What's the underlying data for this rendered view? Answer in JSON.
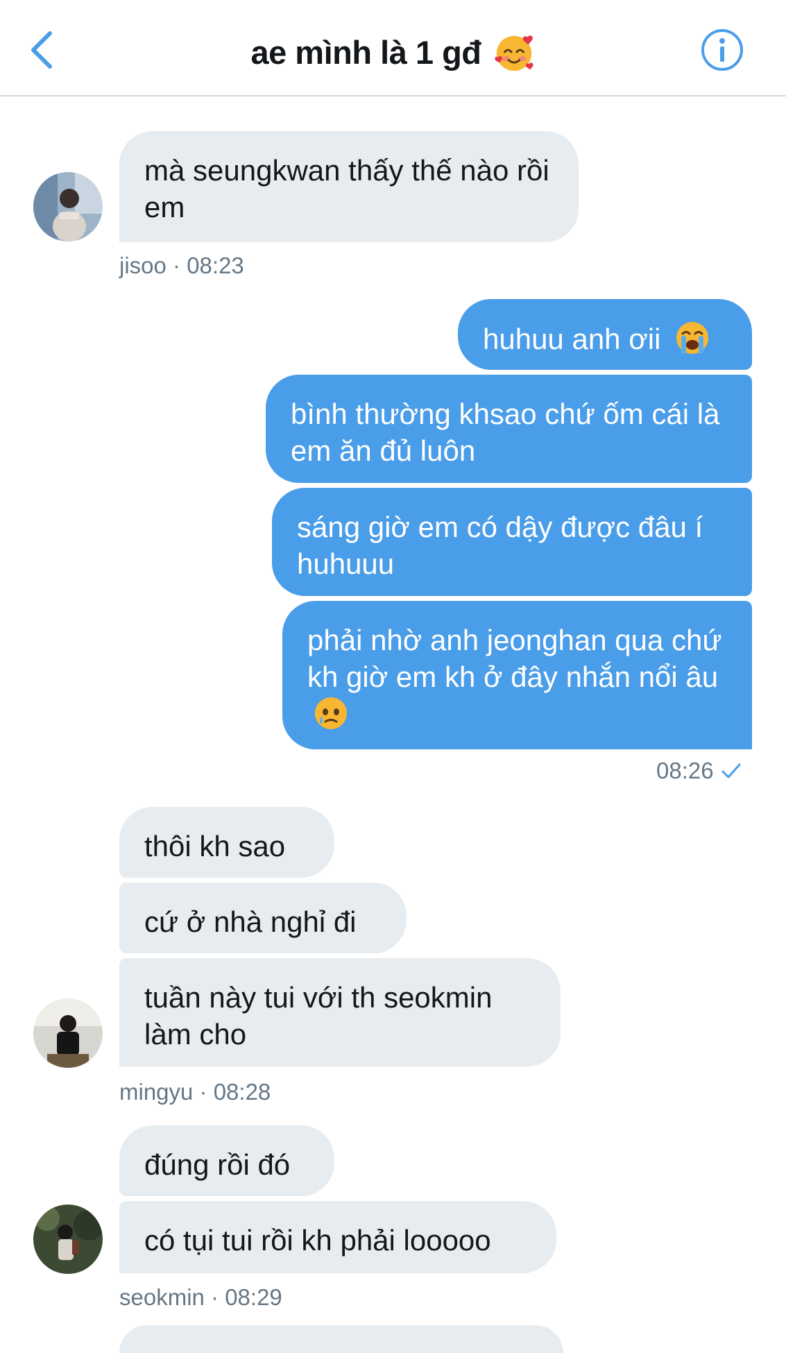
{
  "header": {
    "title": "ae mình là 1 gđ",
    "title_emoji": "smiling-face-with-hearts",
    "accent": "#4a9de8"
  },
  "messages": {
    "m1": "mà seungkwan thấy thế nào rồi em",
    "m1_meta": "jisoo · 08:23",
    "o1": "huhuu anh ơii",
    "o2": "bình thường khsao chứ ốm cái là em ăn đủ luôn",
    "o3": "sáng giờ em có dậy được đâu í huhuuu",
    "o4": "phải nhờ anh jeonghan qua chứ kh giờ em kh ở đây nhắn nổi âu",
    "o_meta": "08:26",
    "g1": "thôi kh sao",
    "g2": "cứ ở nhà nghỉ đi",
    "g3": "tuần này tui với th seokmin làm cho",
    "g_meta": "mingyu · 08:28",
    "s1": "đúng rồi đó",
    "s2": "có tụi tui rồi kh phải looooo",
    "s_meta": "seokmin · 08:29"
  },
  "colors": {
    "incoming_bubble": "#e6ecf0",
    "outgoing_bubble": "#4a9de8",
    "meta_text": "#657786"
  }
}
